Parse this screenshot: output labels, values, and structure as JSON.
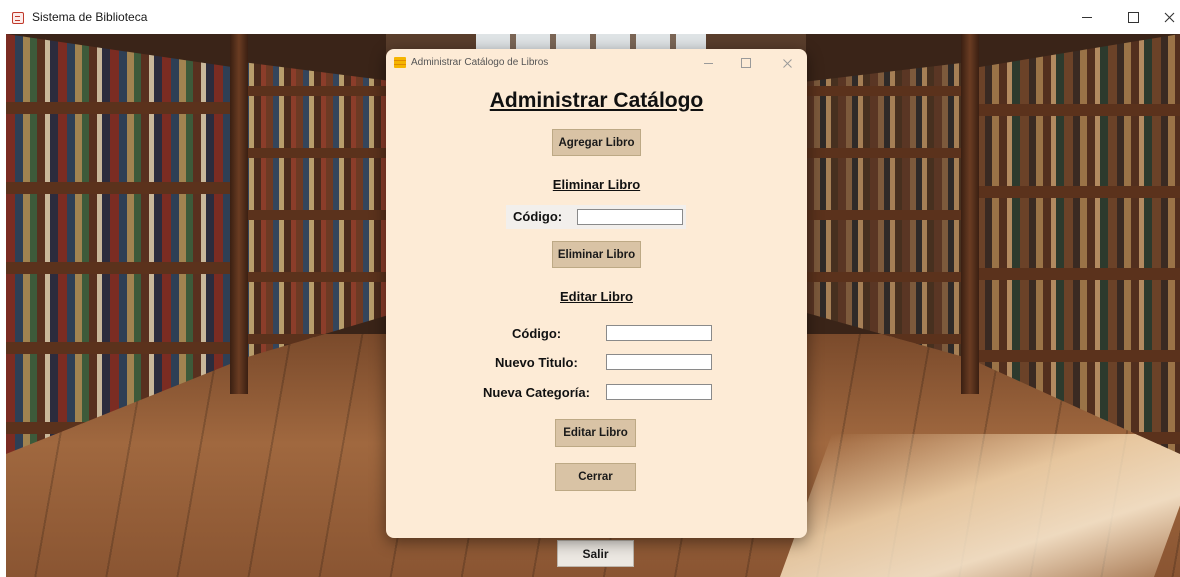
{
  "main_window": {
    "title": "Sistema de Biblioteca",
    "exit_label": "Salir"
  },
  "dialog": {
    "title": "Administrar Catálogo de Libros",
    "heading": "Administrar Catálogo",
    "add_button_label": "Agregar Libro",
    "delete_section": {
      "heading": "Eliminar Libro",
      "code_label": "Código:",
      "code_value": "",
      "button_label": "Eliminar Libro"
    },
    "edit_section": {
      "heading": "Editar Libro",
      "code_label": "Código:",
      "code_value": "",
      "title_label": "Nuevo Titulo:",
      "title_value": "",
      "category_label": "Nueva Categoría:",
      "category_value": "",
      "button_label": "Editar Libro"
    },
    "close_button_label": "Cerrar"
  },
  "colors": {
    "dialog_bg": "#fdebd6",
    "button_bg": "#d9c3a5",
    "exit_button_bg": "#ece8e2"
  },
  "icons": {
    "main_app": "library-app-icon",
    "dialog": "catalog-window-icon"
  }
}
